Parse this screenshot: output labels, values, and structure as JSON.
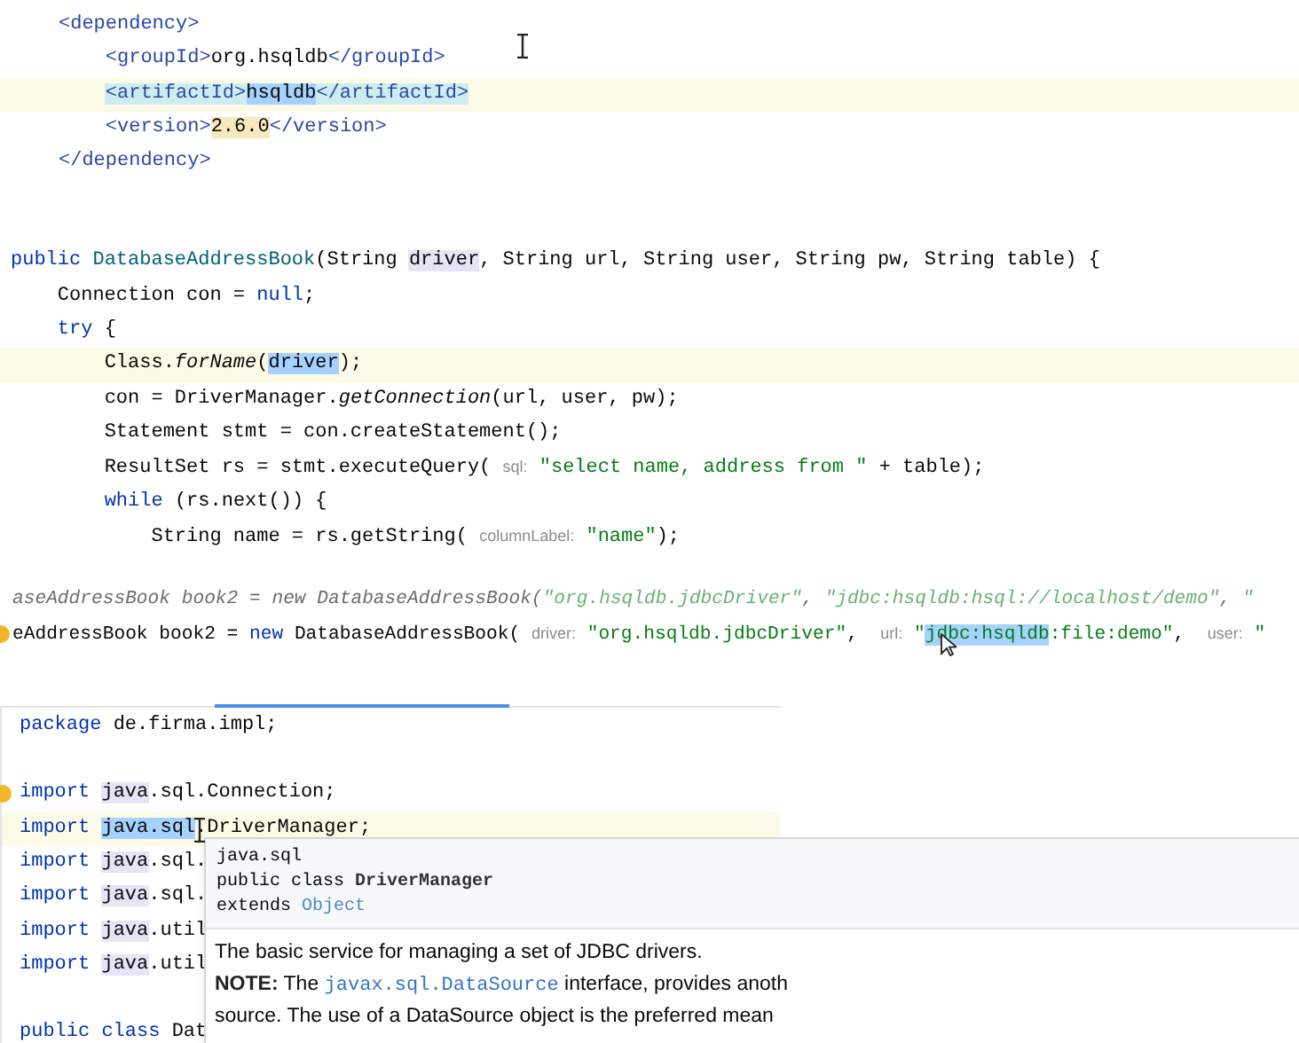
{
  "xml_snippet": {
    "lines": [
      {
        "current": false,
        "tokens": [
          {
            "t": "<dependency>",
            "kind": "tag"
          }
        ]
      },
      {
        "current": false,
        "tokens": [
          {
            "t": "    <groupId>",
            "kind": "tag"
          },
          {
            "t": "org.hsqldb"
          },
          {
            "t": "</groupId>",
            "kind": "tag"
          }
        ]
      },
      {
        "current": true,
        "tokens": [
          {
            "t": "    <artifactId>",
            "kind": "tag",
            "match_highlight": true
          },
          {
            "t": "hsqldb",
            "selected": true
          },
          {
            "t": "</artifactId>",
            "kind": "tag",
            "match_highlight": true
          }
        ]
      },
      {
        "current": false,
        "tokens": [
          {
            "t": "    <version>",
            "kind": "tag"
          },
          {
            "t": "2.6.0",
            "warning_highlight": true
          },
          {
            "t": "</version>",
            "kind": "tag"
          }
        ]
      },
      {
        "current": false,
        "tokens": [
          {
            "t": "</dependency>",
            "kind": "tag"
          }
        ]
      }
    ]
  },
  "constructor_snippet": {
    "lines": [
      {
        "current": false,
        "tokens": [
          {
            "t": "public",
            "kind": "keyword"
          },
          {
            "t": " DatabaseAddressBook",
            "kind": "type"
          },
          {
            "t": "(String "
          },
          {
            "t": "driver",
            "usage_highlight": true
          },
          {
            "t": ", String url, String user, String pw, String table) {"
          }
        ]
      },
      {
        "current": false,
        "tokens": [
          {
            "t": "    Connection con = "
          },
          {
            "t": "null",
            "kind": "keyword"
          },
          {
            "t": ";"
          }
        ]
      },
      {
        "current": false,
        "tokens": [
          {
            "t": "    try",
            "kind": "keyword"
          },
          {
            "t": " {"
          }
        ]
      },
      {
        "current": true,
        "tokens": [
          {
            "t": "        Class."
          },
          {
            "t": "forName",
            "kind": "method"
          },
          {
            "t": "("
          },
          {
            "t": "driver",
            "selected": true
          },
          {
            "t": ");"
          }
        ]
      },
      {
        "current": false,
        "tokens": [
          {
            "t": "        con = DriverManager."
          },
          {
            "t": "getConnection",
            "kind": "method"
          },
          {
            "t": "(url, user, pw);"
          }
        ]
      },
      {
        "current": false,
        "tokens": [
          {
            "t": "        Statement stmt = con.createStatement();"
          }
        ]
      },
      {
        "current": false,
        "tokens": [
          {
            "t": "        ResultSet rs = stmt.executeQuery( "
          },
          {
            "t": "sql:",
            "kind": "hint"
          },
          {
            "t": " \"select name, address from \"",
            "kind": "string"
          },
          {
            "t": " + table);"
          }
        ]
      },
      {
        "current": false,
        "tokens": [
          {
            "t": "        while",
            "kind": "keyword"
          },
          {
            "t": " (rs.next()) {"
          }
        ]
      },
      {
        "current": false,
        "tokens": [
          {
            "t": "            String name = rs.getString( "
          },
          {
            "t": "columnLabel:",
            "kind": "hint"
          },
          {
            "t": " \"name\"",
            "kind": "string"
          },
          {
            "t": ");"
          }
        ]
      }
    ]
  },
  "call_snippet": {
    "lines": [
      {
        "ghost": true,
        "bulb": false,
        "tokens": [
          {
            "t": "aseAddressBook book2 = new DatabaseAddressBook("
          },
          {
            "t": "\"org.hsqldb.jdbcDriver\"",
            "kind": "string"
          },
          {
            "t": ", "
          },
          {
            "t": "\"jdbc:hsqldb:hsql://localhost/demo\"",
            "kind": "string"
          },
          {
            "t": ", "
          },
          {
            "t": "\"",
            "kind": "string"
          }
        ]
      },
      {
        "ghost": false,
        "bulb": true,
        "tokens": [
          {
            "t": "eAddressBook book2 = "
          },
          {
            "t": "new",
            "kind": "keyword"
          },
          {
            "t": " DatabaseAddressBook( "
          },
          {
            "t": "driver:",
            "kind": "hint"
          },
          {
            "t": " \"org.hsqldb.jdbcDriver\"",
            "kind": "string"
          },
          {
            "t": ",  "
          },
          {
            "t": "url:",
            "kind": "hint"
          },
          {
            "t": " \"",
            "kind": "string"
          },
          {
            "t": "jdbc:hsqldb",
            "kind": "string",
            "selected": true
          },
          {
            "t": ":file:demo\"",
            "kind": "string"
          },
          {
            "t": ",  "
          },
          {
            "t": "user:",
            "kind": "hint"
          },
          {
            "t": " \"",
            "kind": "string"
          }
        ]
      }
    ]
  },
  "imports_snippet": {
    "lines": [
      {
        "current": false,
        "bulb": false,
        "tokens": [
          {
            "t": "package",
            "kind": "keyword"
          },
          {
            "t": " de.firma.impl;"
          }
        ]
      },
      {
        "current": false,
        "bulb": false
      },
      {
        "current": false,
        "bulb": true,
        "tokens": [
          {
            "t": "import",
            "kind": "keyword"
          },
          {
            "t": " java",
            "usage_highlight": true
          },
          {
            "t": ".sql.Connection;"
          }
        ]
      },
      {
        "current": true,
        "bulb": false,
        "tokens": [
          {
            "t": "import",
            "kind": "keyword"
          },
          {
            "t": " java.sql",
            "selected": true
          },
          {
            "t": ".DriverManager;"
          }
        ]
      },
      {
        "current": false,
        "bulb": false,
        "tokens": [
          {
            "t": "import",
            "kind": "keyword"
          },
          {
            "t": " java",
            "usage_highlight": true
          },
          {
            "t": ".sql."
          }
        ]
      },
      {
        "current": false,
        "bulb": false,
        "tokens": [
          {
            "t": "import",
            "kind": "keyword"
          },
          {
            "t": " java",
            "usage_highlight": true
          },
          {
            "t": ".sql."
          }
        ]
      },
      {
        "current": false,
        "bulb": false,
        "tokens": [
          {
            "t": "import",
            "kind": "keyword"
          },
          {
            "t": " java",
            "usage_highlight": true
          },
          {
            "t": ".util"
          }
        ]
      },
      {
        "current": false,
        "bulb": false,
        "tokens": [
          {
            "t": "import",
            "kind": "keyword"
          },
          {
            "t": " java",
            "usage_highlight": true
          },
          {
            "t": ".util"
          }
        ]
      },
      {
        "current": false,
        "bulb": false
      },
      {
        "current": false,
        "bulb": false,
        "tokens": [
          {
            "t": "public class",
            "kind": "keyword"
          },
          {
            "t": " Dat"
          }
        ]
      }
    ]
  },
  "doc_tooltip": {
    "header": [
      [
        {
          "t": "java.sql"
        }
      ],
      [
        {
          "t": "public class "
        },
        {
          "t": "DriverManager",
          "kind": "bold"
        }
      ],
      [
        {
          "t": "extends "
        },
        {
          "t": "Object",
          "kind": "link"
        }
      ]
    ],
    "body": [
      [
        {
          "t": "The basic service for managing a set of JDBC drivers."
        }
      ],
      [
        {
          "t": "NOTE:",
          "kind": "bold"
        },
        {
          "t": " The "
        },
        {
          "t": "javax.sql.DataSource",
          "kind": "code"
        },
        {
          "t": " interface, provides anoth"
        }
      ],
      [
        {
          "t": "source. The use of a DataSource object is the preferred mean"
        }
      ]
    ]
  }
}
